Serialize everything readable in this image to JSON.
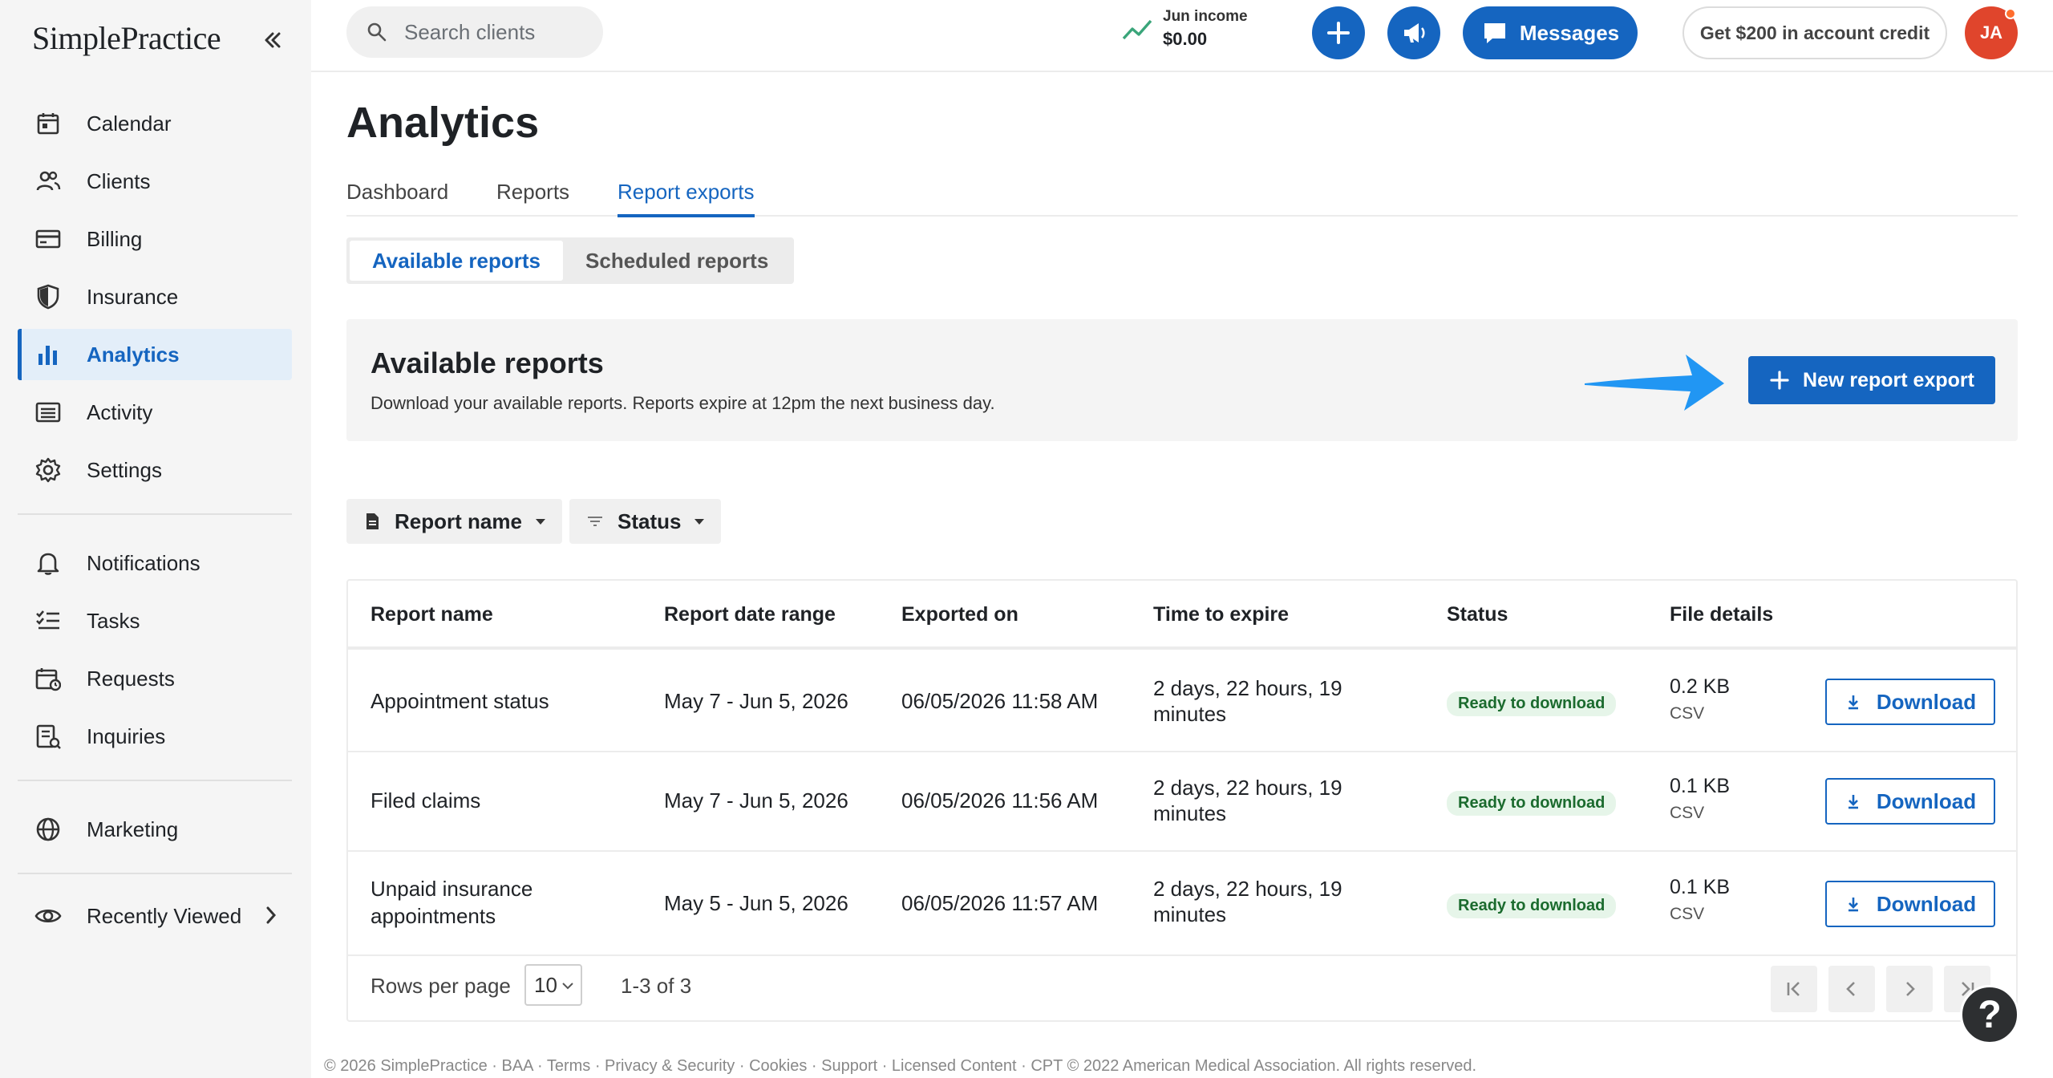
{
  "app": {
    "logo": "SimplePractice"
  },
  "sidebar": {
    "items": [
      {
        "label": "Calendar",
        "icon": "calendar-icon"
      },
      {
        "label": "Clients",
        "icon": "clients-icon"
      },
      {
        "label": "Billing",
        "icon": "billing-icon"
      },
      {
        "label": "Insurance",
        "icon": "shield-icon"
      },
      {
        "label": "Analytics",
        "icon": "bar-chart-icon",
        "active": true
      },
      {
        "label": "Activity",
        "icon": "activity-icon"
      },
      {
        "label": "Settings",
        "icon": "gear-icon"
      },
      {
        "label": "Notifications",
        "icon": "bell-icon"
      },
      {
        "label": "Tasks",
        "icon": "tasks-icon"
      },
      {
        "label": "Requests",
        "icon": "requests-icon"
      },
      {
        "label": "Inquiries",
        "icon": "inquiries-icon"
      },
      {
        "label": "Marketing",
        "icon": "globe-icon"
      },
      {
        "label": "Recently Viewed",
        "icon": "eye-icon"
      }
    ]
  },
  "topbar": {
    "search_placeholder": "Search clients",
    "income_label": "Jun income",
    "income_value": "$0.00",
    "messages_label": "Messages",
    "credit_label": "Get $200 in account credit",
    "avatar_initials": "JA"
  },
  "main": {
    "title": "Analytics",
    "tabs": [
      {
        "label": "Dashboard"
      },
      {
        "label": "Reports"
      },
      {
        "label": "Report exports",
        "active": true
      }
    ],
    "segments": [
      {
        "label": "Available reports",
        "active": true
      },
      {
        "label": "Scheduled reports"
      }
    ],
    "panel": {
      "title": "Available reports",
      "description": "Download your available reports. Reports expire at 12pm the next business day.",
      "new_export_label": "New report export"
    },
    "filters": {
      "report_name": "Report name",
      "status": "Status"
    },
    "table": {
      "headers": [
        "Report name",
        "Report date range",
        "Exported on",
        "Time to expire",
        "Status",
        "File details"
      ],
      "rows": [
        {
          "name": "Appointment status",
          "range": "May 7 - Jun 5, 2026",
          "exported": "06/05/2026 11:58 AM",
          "expire_1": "2 days, 22 hours, 19",
          "expire_2": "minutes",
          "status": "Ready to download",
          "size": "0.2 KB",
          "type": "CSV",
          "action": "Download"
        },
        {
          "name": "Filed claims",
          "range": "May 7 - Jun 5, 2026",
          "exported": "06/05/2026 11:56 AM",
          "expire_1": "2 days, 22 hours, 19",
          "expire_2": "minutes",
          "status": "Ready to download",
          "size": "0.1 KB",
          "type": "CSV",
          "action": "Download"
        },
        {
          "name_1": "Unpaid insurance",
          "name_2": "appointments",
          "range": "May 5 - Jun 5, 2026",
          "exported": "06/05/2026 11:57 AM",
          "expire_1": "2 days, 22 hours, 19",
          "expire_2": "minutes",
          "status": "Ready to download",
          "size": "0.1 KB",
          "type": "CSV",
          "action": "Download"
        }
      ]
    },
    "pagination": {
      "rows_label": "Rows per page",
      "rows_value": "10",
      "range_label": "1-3 of 3"
    }
  },
  "help_label": "?",
  "footer": "© 2026 SimplePractice · BAA · Terms · Privacy & Security · Cookies · Support · Licensed Content · CPT © 2022 American Medical Association. All rights reserved.",
  "colors": {
    "accent": "#1565c0",
    "badge_bg": "#e6f5e9",
    "badge_text": "#1b6b2e",
    "avatar": "#e0452c",
    "arrow": "#2196f3"
  }
}
